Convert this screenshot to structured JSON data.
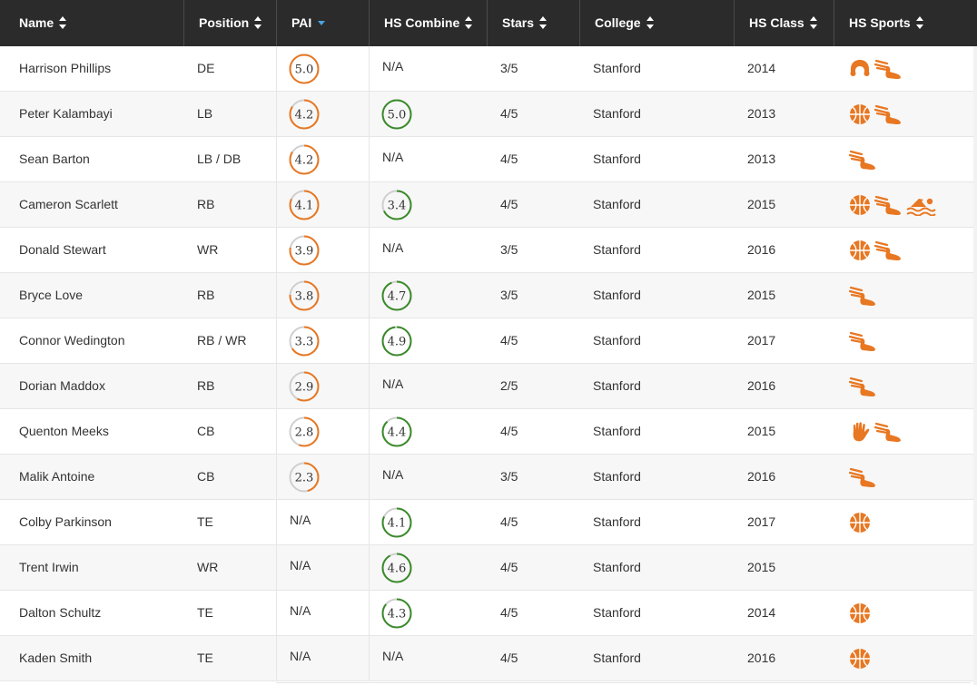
{
  "colors": {
    "header_bg": "#2b2b2b",
    "pai_ring": "#e87722",
    "combine_ring": "#3a8a2a",
    "empty_ring": "#cfcfcf",
    "icon_color": "#e87722",
    "sort_active": "#4aa3df"
  },
  "columns": [
    {
      "label": "Name",
      "sort": "both"
    },
    {
      "label": "Position",
      "sort": "both"
    },
    {
      "label": "PAI",
      "sort": "desc-active"
    },
    {
      "label": "HS Combine",
      "sort": "both"
    },
    {
      "label": "Stars",
      "sort": "both"
    },
    {
      "label": "College",
      "sort": "both"
    },
    {
      "label": "HS Class",
      "sort": "both"
    },
    {
      "label": "HS Sports",
      "sort": "both"
    }
  ],
  "rows": [
    {
      "name": "Harrison Phillips",
      "position": "DE",
      "pai": "5.0",
      "pai_pct": 1.0,
      "combine": "N/A",
      "combine_pct": null,
      "stars": "3/5",
      "college": "Stanford",
      "class": "2014",
      "sports": [
        "wrestling-icon",
        "track-icon"
      ]
    },
    {
      "name": "Peter Kalambayi",
      "position": "LB",
      "pai": "4.2",
      "pai_pct": 0.84,
      "combine": "5.0",
      "combine_pct": 1.0,
      "stars": "4/5",
      "college": "Stanford",
      "class": "2013",
      "sports": [
        "basketball-icon",
        "track-icon"
      ]
    },
    {
      "name": "Sean Barton",
      "position": "LB / DB",
      "pai": "4.2",
      "pai_pct": 0.84,
      "combine": "N/A",
      "combine_pct": null,
      "stars": "4/5",
      "college": "Stanford",
      "class": "2013",
      "sports": [
        "track-icon"
      ]
    },
    {
      "name": "Cameron Scarlett",
      "position": "RB",
      "pai": "4.1",
      "pai_pct": 0.82,
      "combine": "3.4",
      "combine_pct": 0.68,
      "stars": "4/5",
      "college": "Stanford",
      "class": "2015",
      "sports": [
        "basketball-icon",
        "track-icon",
        "swimming-icon"
      ]
    },
    {
      "name": "Donald Stewart",
      "position": "WR",
      "pai": "3.9",
      "pai_pct": 0.78,
      "combine": "N/A",
      "combine_pct": null,
      "stars": "3/5",
      "college": "Stanford",
      "class": "2016",
      "sports": [
        "basketball-icon",
        "track-icon"
      ]
    },
    {
      "name": "Bryce Love",
      "position": "RB",
      "pai": "3.8",
      "pai_pct": 0.76,
      "combine": "4.7",
      "combine_pct": 0.94,
      "stars": "3/5",
      "college": "Stanford",
      "class": "2015",
      "sports": [
        "track-icon"
      ]
    },
    {
      "name": "Connor Wedington",
      "position": "RB / WR",
      "pai": "3.3",
      "pai_pct": 0.66,
      "combine": "4.9",
      "combine_pct": 0.98,
      "stars": "4/5",
      "college": "Stanford",
      "class": "2017",
      "sports": [
        "track-icon"
      ]
    },
    {
      "name": "Dorian Maddox",
      "position": "RB",
      "pai": "2.9",
      "pai_pct": 0.58,
      "combine": "N/A",
      "combine_pct": null,
      "stars": "2/5",
      "college": "Stanford",
      "class": "2016",
      "sports": [
        "track-icon"
      ]
    },
    {
      "name": "Quenton Meeks",
      "position": "CB",
      "pai": "2.8",
      "pai_pct": 0.56,
      "combine": "4.4",
      "combine_pct": 0.88,
      "stars": "4/5",
      "college": "Stanford",
      "class": "2015",
      "sports": [
        "baseball-glove-icon",
        "track-icon"
      ]
    },
    {
      "name": "Malik Antoine",
      "position": "CB",
      "pai": "2.3",
      "pai_pct": 0.46,
      "combine": "N/A",
      "combine_pct": null,
      "stars": "3/5",
      "college": "Stanford",
      "class": "2016",
      "sports": [
        "track-icon"
      ]
    },
    {
      "name": "Colby Parkinson",
      "position": "TE",
      "pai": "N/A",
      "pai_pct": null,
      "combine": "4.1",
      "combine_pct": 0.82,
      "stars": "4/5",
      "college": "Stanford",
      "class": "2017",
      "sports": [
        "basketball-icon"
      ]
    },
    {
      "name": "Trent Irwin",
      "position": "WR",
      "pai": "N/A",
      "pai_pct": null,
      "combine": "4.6",
      "combine_pct": 0.92,
      "stars": "4/5",
      "college": "Stanford",
      "class": "2015",
      "sports": []
    },
    {
      "name": "Dalton Schultz",
      "position": "TE",
      "pai": "N/A",
      "pai_pct": null,
      "combine": "4.3",
      "combine_pct": 0.86,
      "stars": "4/5",
      "college": "Stanford",
      "class": "2014",
      "sports": [
        "basketball-icon"
      ]
    },
    {
      "name": "Kaden Smith",
      "position": "TE",
      "pai": "N/A",
      "pai_pct": null,
      "combine": "N/A",
      "combine_pct": null,
      "stars": "4/5",
      "college": "Stanford",
      "class": "2016",
      "sports": [
        "basketball-icon"
      ]
    }
  ]
}
